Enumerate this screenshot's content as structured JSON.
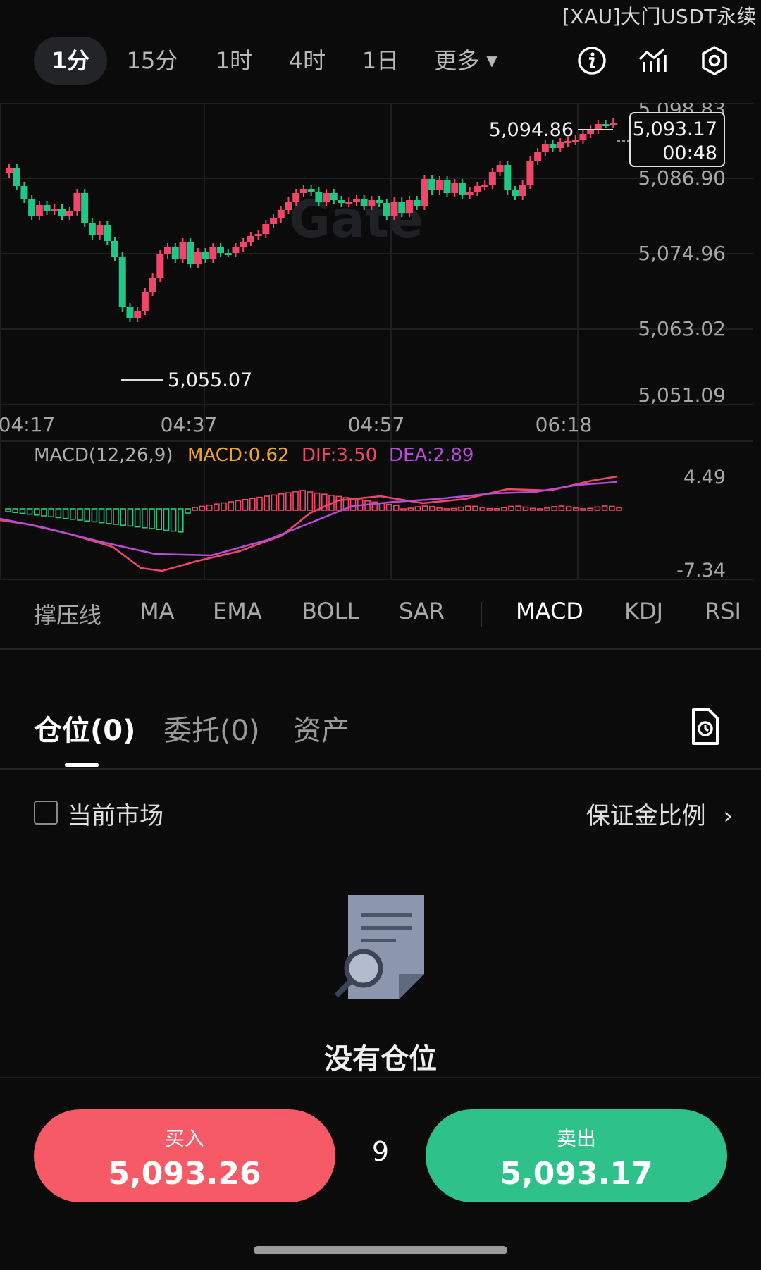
{
  "overlay_title": "[XAU]大门USDT永续",
  "timeframes": [
    "1分",
    "15分",
    "1时",
    "4时",
    "1日",
    "更多"
  ],
  "timeframe_active": "1分",
  "toolbar_icons": [
    "info-icon",
    "indicator-chart-icon",
    "settings-icon"
  ],
  "chart": {
    "watermark": "Gate",
    "price_ticks": [
      "5,098.83",
      "5,086.90",
      "5,074.96",
      "5,063.02",
      "5,051.09"
    ],
    "time_ticks": [
      "04:17",
      "04:37",
      "04:57",
      "06:18"
    ],
    "high_marker": "5,094.86",
    "low_marker": "5,055.07",
    "last_price": "5,093.17",
    "countdown": "00:48",
    "colors": {
      "up": "#f0466a",
      "down": "#21c786",
      "grid": "#1c1c1e"
    }
  },
  "macd": {
    "title": "MACD(12,26,9)",
    "macd_value": "MACD:0.62",
    "dif_value": "DIF:3.50",
    "dea_value": "DEA:2.89",
    "scale_top": "4.49",
    "scale_bottom": "-7.34",
    "colors": {
      "macd": "#f0a623",
      "dif": "#f0466a",
      "dea": "#b84bd9"
    }
  },
  "indicators": [
    "撑压线",
    "MA",
    "EMA",
    "BOLL",
    "SAR",
    "MACD",
    "KDJ",
    "RSI"
  ],
  "indicator_active": "MACD",
  "tabs": [
    "仓位(0)",
    "委托(0)",
    "资产"
  ],
  "tab_active": "仓位(0)",
  "filter": {
    "current_market": "当前市场",
    "margin_ratio": "保证金比例"
  },
  "empty_state": "没有仓位",
  "buy": {
    "label": "买入",
    "price": "5,093.26"
  },
  "sell": {
    "label": "卖出",
    "price": "5,093.17"
  },
  "leverage": "9"
}
